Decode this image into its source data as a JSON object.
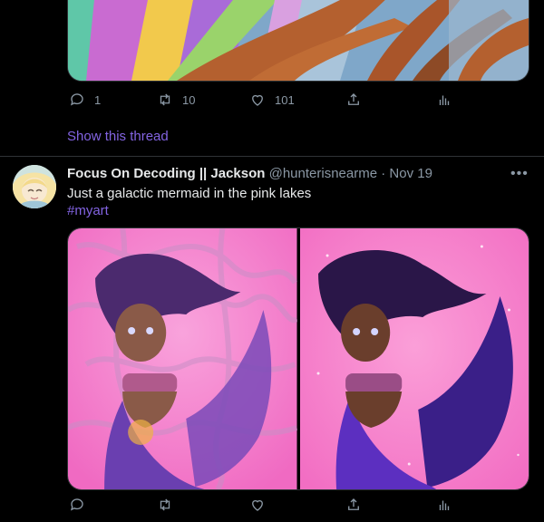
{
  "prev_tweet": {
    "actions": {
      "reply_count": "1",
      "retweet_count": "10",
      "like_count": "101"
    },
    "show_thread_label": "Show this thread"
  },
  "tweet": {
    "display_name": "Focus On Decoding || Jackson",
    "handle": "@hunterisnearme",
    "separator": "·",
    "date": "Nov 19",
    "more_label": "•••",
    "text": "Just a galactic mermaid in the pink lakes",
    "hashtag": "#myart",
    "media": {
      "count": 2
    },
    "actions": {
      "reply_count": "",
      "retweet_count": "",
      "like_count": ""
    }
  },
  "icons": [
    "reply-icon",
    "retweet-icon",
    "like-icon",
    "share-icon",
    "analytics-icon",
    "more-icon"
  ],
  "colors": {
    "background": "#000000",
    "accent": "#8364e2",
    "muted": "#8b98a5",
    "text": "#e7e9ea",
    "divider": "#2f3336",
    "media_pink": "#f372c5"
  }
}
